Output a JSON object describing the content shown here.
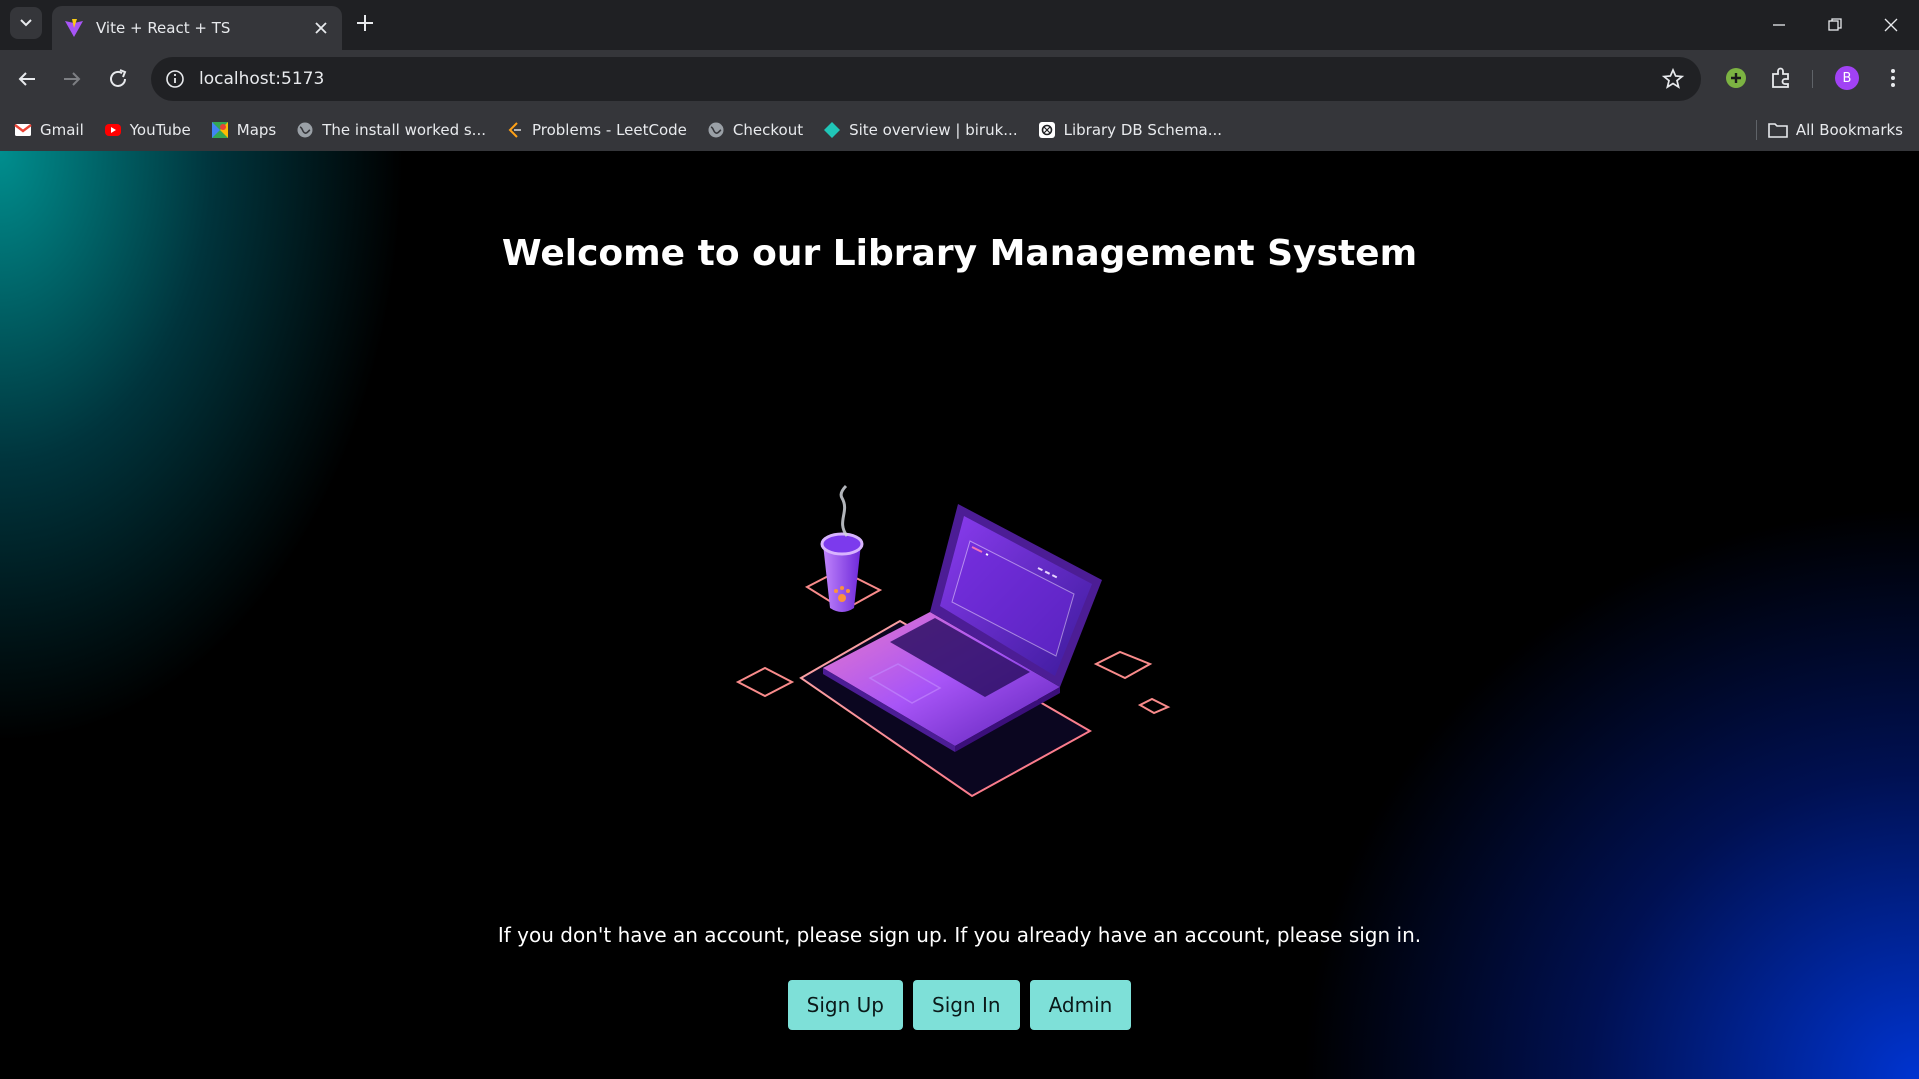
{
  "browser": {
    "tab_title": "Vite + React + TS",
    "url": "localhost:5173",
    "avatar_letter": "B",
    "bookmarks": [
      {
        "label": "Gmail",
        "icon": "gmail-icon"
      },
      {
        "label": "YouTube",
        "icon": "youtube-icon"
      },
      {
        "label": "Maps",
        "icon": "maps-icon"
      },
      {
        "label": "The install worked s...",
        "icon": "globe-icon"
      },
      {
        "label": "Problems - LeetCode",
        "icon": "leetcode-icon"
      },
      {
        "label": "Checkout",
        "icon": "globe-icon"
      },
      {
        "label": "Site overview | biruk...",
        "icon": "netlify-icon"
      },
      {
        "label": "Library DB Schema...",
        "icon": "chatgpt-icon"
      }
    ],
    "all_bookmarks_label": "All Bookmarks"
  },
  "page": {
    "heading": "Welcome to our Library Management System",
    "subtitle": "If you don't have an account, please sign up. If you already have an account, please sign in.",
    "buttons": {
      "sign_up": "Sign Up",
      "sign_in": "Sign In",
      "admin": "Admin"
    },
    "illustration": "laptop-and-coffee-illustration"
  },
  "colors": {
    "button_bg": "#7ee0d8",
    "gradient_teal": "#009696",
    "gradient_blue": "#0037dc"
  }
}
